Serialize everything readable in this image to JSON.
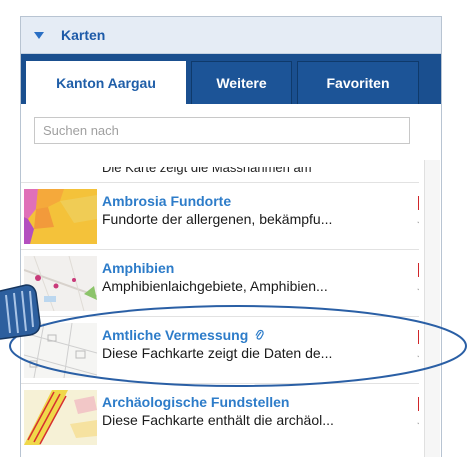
{
  "panel": {
    "title": "Karten"
  },
  "tabs": [
    {
      "label": "Kanton Aargau",
      "active": true
    },
    {
      "label": "Weitere",
      "active": false
    },
    {
      "label": "Favoriten",
      "active": false
    }
  ],
  "search": {
    "placeholder": "Suchen nach",
    "value": ""
  },
  "list": {
    "cut_off_text": "Die Karte zeigt die Massnahmen am",
    "items": [
      {
        "title": "Ambrosia Fundorte",
        "description": "Fundorte der allergenen, bekämpfu...",
        "thumbnail": "map-thumbnail-ambrosia",
        "has_attachment": false
      },
      {
        "title": "Amphibien",
        "description": "Amphibienlaichgebiete, Amphibien...",
        "thumbnail": "map-thumbnail-amphibien",
        "has_attachment": false
      },
      {
        "title": "Amtliche Vermessung",
        "description": "Diese Fachkarte zeigt die Daten de...",
        "thumbnail": "map-thumbnail-vermessung",
        "has_attachment": true
      },
      {
        "title": "Archäologische Fundstellen",
        "description": "Diese Fachkarte enthält die archäol...",
        "thumbnail": "map-thumbnail-archaeologie",
        "has_attachment": false
      }
    ]
  },
  "icons": {
    "collapse": "chevron-down-icon",
    "pdf": "pdf-icon",
    "favorite": "star-outline-icon",
    "attachment": "paperclip-icon",
    "pointer": "hand-pointer-icon"
  },
  "colors": {
    "header_bg": "#e5ecf5",
    "tabbar_bg": "#1a4f8f",
    "title_link": "#2d7cc9",
    "pdf_red": "#d0262a",
    "highlight_ellipse": "#2a5fa5"
  }
}
